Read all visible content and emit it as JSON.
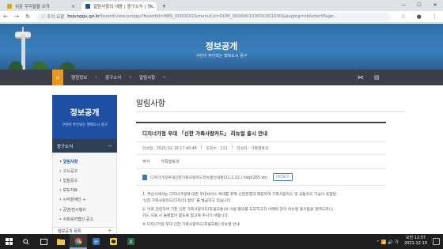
{
  "browser": {
    "tabs": [
      {
        "title": "쉬운 우리말을 쓰자",
        "favicon_color": "#e8a317",
        "active": false
      },
      {
        "title": "알림사항의 내용 | 중구소식 | 정...",
        "favicon_color": "#1f4fa3",
        "active": true
      }
    ],
    "new_tab": "+",
    "window_controls": [
      "—",
      "☐",
      "✕"
    ],
    "security_label": "ⓘ 주의 요함",
    "url_domain": "bsjunggu.go.kr",
    "url_path": "/board/view.junggu?boardId=BBS_0000001&menuCd=DOM_000000103001001000&paging=ok&startPage..."
  },
  "banner": {
    "title": "정보공개",
    "subtitle": "구민이 주인되는 행복도시 중구"
  },
  "breadcrumb": {
    "items": [
      "행정정보",
      "중구소식",
      "알림사항"
    ]
  },
  "sidebar": {
    "title": "정보공개",
    "subtitle": "구민이 주인되는 행복도시 중구",
    "section": "중구소식",
    "section_toggle": "—",
    "items": [
      {
        "label": "• 알림사항",
        "active": true
      },
      {
        "label": "• 고시공고",
        "active": false
      },
      {
        "label": "• 입찰공고",
        "active": false
      },
      {
        "label": "• 보도자료",
        "active": false
      },
      {
        "label": "• 시각장애인 +",
        "active": false
      },
      {
        "label": "• 공연/전시행사",
        "active": false
      },
      {
        "label": "• 사회복지법인 공고",
        "active": false
      }
    ],
    "bottom_label": "정보공개 목록",
    "bottom_toggle": "+"
  },
  "main": {
    "title": "알림사항",
    "post_title": "디지너가정 우대 「신한 가족사랑카드」 리뉴얼 출시 안내",
    "meta": {
      "date_label": "작성일 : 2021-02-18 17:40:46",
      "views_label": "조회수 : 112",
      "author_label": "작성자 : 가족행복과"
    },
    "dept_label": "부서",
    "dept_value": "가족행복과",
    "attachment": "디지너가정우대신한가족사랑카드리뉴얼안내문(21.2.22.).hwp(265 kb)",
    "preview_button": "미리보기",
    "body": [
      "1. 부산시에서는 디지너가정에 대한 우대서비스 확대를 위해 신한은행과 제휴하여 가족사랑카드 및 교통카드 기능이 포함된",
      "'신한 가족사랑카드(디지너) 멀티' 를 발급하고 있습니다.",
      "2. 이와 관련하여 기존 신한 가족사랑카드(후불교통)의 이용 편의를 도모하고자 아래와 같이 리뉴얼 출시됨을 알려드리니,",
      "카드 사용 시 불편함이 없도록 참고해 주시기 바랍니다.",
      "※ 디지너가정 우대 신한 가족사랑카드(후불교통) 리뉴얼 안내"
    ]
  },
  "taskbar": {
    "apps": [
      "windows-logo",
      "search",
      "task-view",
      "explorer",
      "chrome",
      "hangul",
      "kakaotalk",
      "excel"
    ],
    "tray": "^ 📶 🔊 가",
    "time": "오전 12:57",
    "date": "2021-12-10"
  }
}
